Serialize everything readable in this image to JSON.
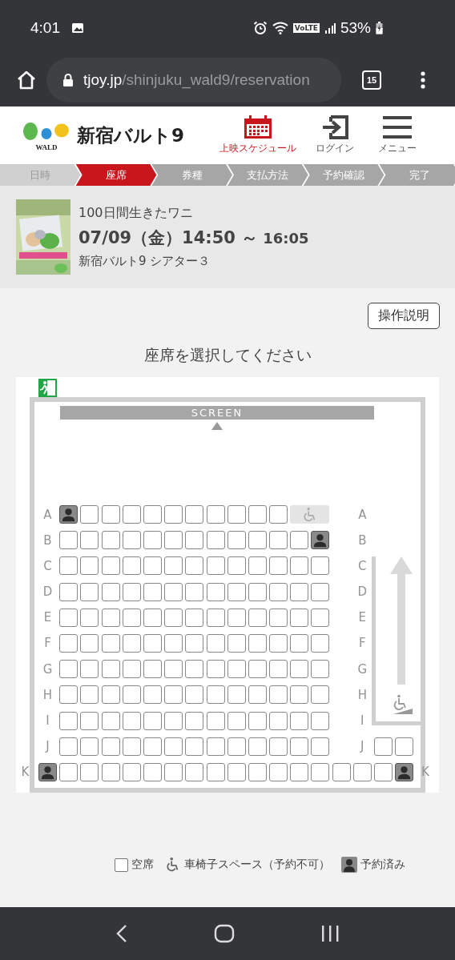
{
  "status_bar": {
    "time": "4:01",
    "network": "VoLTE",
    "battery": "53%"
  },
  "browser": {
    "domain": "tjoy.jp",
    "path": "/shinjuku_wald9/reservation",
    "tabs_count": "15"
  },
  "header": {
    "logo_mark": "WALD",
    "site_name": "新宿バルト9",
    "nav": [
      {
        "label": "上映スケジュール",
        "kind": "schedule"
      },
      {
        "label": "ログイン",
        "kind": "login"
      },
      {
        "label": "メニュー",
        "kind": "menu"
      }
    ]
  },
  "steps": [
    {
      "label": "日時",
      "selected": false
    },
    {
      "label": "座席",
      "selected": true
    },
    {
      "label": "券種",
      "selected": false
    },
    {
      "label": "支払方法",
      "selected": false
    },
    {
      "label": "予約確認",
      "selected": false
    },
    {
      "label": "完了",
      "selected": false
    }
  ],
  "movie": {
    "title": "100日間生きたワニ",
    "start": "07/09（金）14:50 ～",
    "end": "16:05",
    "theater": "新宿バルト9 シアター３"
  },
  "help_button": "操作説明",
  "instruction": "座席を選択してください",
  "seat_map": {
    "screen_label": "SCREEN",
    "rows": [
      {
        "label_left": "A",
        "label_right": "A",
        "kind": "standard",
        "seats": [
          {
            "kind": "seat",
            "reserved": true
          },
          {
            "kind": "seat",
            "reserved": false
          },
          {
            "kind": "seat",
            "reserved": false
          },
          {
            "kind": "seat",
            "reserved": false
          },
          {
            "kind": "seat",
            "reserved": false
          },
          {
            "kind": "seat",
            "reserved": false
          },
          {
            "kind": "seat",
            "reserved": false
          },
          {
            "kind": "seat",
            "reserved": false
          },
          {
            "kind": "seat",
            "reserved": false
          },
          {
            "kind": "seat",
            "reserved": false
          },
          {
            "kind": "seat",
            "reserved": false
          },
          {
            "kind": "wheelchair"
          }
        ]
      },
      {
        "label_left": "B",
        "label_right": "B",
        "kind": "standard",
        "seats": [
          {
            "kind": "seat",
            "reserved": false
          },
          {
            "kind": "seat",
            "reserved": false
          },
          {
            "kind": "seat",
            "reserved": false
          },
          {
            "kind": "seat",
            "reserved": false
          },
          {
            "kind": "seat",
            "reserved": false
          },
          {
            "kind": "seat",
            "reserved": false
          },
          {
            "kind": "seat",
            "reserved": false
          },
          {
            "kind": "seat",
            "reserved": false
          },
          {
            "kind": "seat",
            "reserved": false
          },
          {
            "kind": "seat",
            "reserved": false
          },
          {
            "kind": "seat",
            "reserved": false
          },
          {
            "kind": "seat",
            "reserved": false
          },
          {
            "kind": "seat",
            "reserved": true
          }
        ]
      },
      {
        "label_left": "C",
        "label_right": "C",
        "kind": "standard",
        "seats": [
          {
            "kind": "seat",
            "reserved": false
          },
          {
            "kind": "seat",
            "reserved": false
          },
          {
            "kind": "seat",
            "reserved": false
          },
          {
            "kind": "seat",
            "reserved": false
          },
          {
            "kind": "seat",
            "reserved": false
          },
          {
            "kind": "seat",
            "reserved": false
          },
          {
            "kind": "seat",
            "reserved": false
          },
          {
            "kind": "seat",
            "reserved": false
          },
          {
            "kind": "seat",
            "reserved": false
          },
          {
            "kind": "seat",
            "reserved": false
          },
          {
            "kind": "seat",
            "reserved": false
          },
          {
            "kind": "seat",
            "reserved": false
          },
          {
            "kind": "seat",
            "reserved": false
          }
        ]
      },
      {
        "label_left": "D",
        "label_right": "D",
        "kind": "standard",
        "seats": [
          {
            "kind": "seat",
            "reserved": false
          },
          {
            "kind": "seat",
            "reserved": false
          },
          {
            "kind": "seat",
            "reserved": false
          },
          {
            "kind": "seat",
            "reserved": false
          },
          {
            "kind": "seat",
            "reserved": false
          },
          {
            "kind": "seat",
            "reserved": false
          },
          {
            "kind": "seat",
            "reserved": false
          },
          {
            "kind": "seat",
            "reserved": false
          },
          {
            "kind": "seat",
            "reserved": false
          },
          {
            "kind": "seat",
            "reserved": false
          },
          {
            "kind": "seat",
            "reserved": false
          },
          {
            "kind": "seat",
            "reserved": false
          },
          {
            "kind": "seat",
            "reserved": false
          }
        ]
      },
      {
        "label_left": "E",
        "label_right": "E",
        "kind": "standard",
        "seats": [
          {
            "kind": "seat",
            "reserved": false
          },
          {
            "kind": "seat",
            "reserved": false
          },
          {
            "kind": "seat",
            "reserved": false
          },
          {
            "kind": "seat",
            "reserved": false
          },
          {
            "kind": "seat",
            "reserved": false
          },
          {
            "kind": "seat",
            "reserved": false
          },
          {
            "kind": "seat",
            "reserved": false
          },
          {
            "kind": "seat",
            "reserved": false
          },
          {
            "kind": "seat",
            "reserved": false
          },
          {
            "kind": "seat",
            "reserved": false
          },
          {
            "kind": "seat",
            "reserved": false
          },
          {
            "kind": "seat",
            "reserved": false
          },
          {
            "kind": "seat",
            "reserved": false
          }
        ]
      },
      {
        "label_left": "F",
        "label_right": "F",
        "kind": "standard",
        "seats": [
          {
            "kind": "seat",
            "reserved": false
          },
          {
            "kind": "seat",
            "reserved": false
          },
          {
            "kind": "seat",
            "reserved": false
          },
          {
            "kind": "seat",
            "reserved": false
          },
          {
            "kind": "seat",
            "reserved": false
          },
          {
            "kind": "seat",
            "reserved": false
          },
          {
            "kind": "seat",
            "reserved": false
          },
          {
            "kind": "seat",
            "reserved": false
          },
          {
            "kind": "seat",
            "reserved": false
          },
          {
            "kind": "seat",
            "reserved": false
          },
          {
            "kind": "seat",
            "reserved": false
          },
          {
            "kind": "seat",
            "reserved": false
          },
          {
            "kind": "seat",
            "reserved": false
          }
        ]
      },
      {
        "label_left": "G",
        "label_right": "G",
        "kind": "standard",
        "seats": [
          {
            "kind": "seat",
            "reserved": false
          },
          {
            "kind": "seat",
            "reserved": false
          },
          {
            "kind": "seat",
            "reserved": false
          },
          {
            "kind": "seat",
            "reserved": false
          },
          {
            "kind": "seat",
            "reserved": false
          },
          {
            "kind": "seat",
            "reserved": false
          },
          {
            "kind": "seat",
            "reserved": false
          },
          {
            "kind": "seat",
            "reserved": false
          },
          {
            "kind": "seat",
            "reserved": false
          },
          {
            "kind": "seat",
            "reserved": false
          },
          {
            "kind": "seat",
            "reserved": false
          },
          {
            "kind": "seat",
            "reserved": false
          },
          {
            "kind": "seat",
            "reserved": false
          }
        ]
      },
      {
        "label_left": "H",
        "label_right": "H",
        "kind": "standard",
        "seats": [
          {
            "kind": "seat",
            "reserved": false
          },
          {
            "kind": "seat",
            "reserved": false
          },
          {
            "kind": "seat",
            "reserved": false
          },
          {
            "kind": "seat",
            "reserved": false
          },
          {
            "kind": "seat",
            "reserved": false
          },
          {
            "kind": "seat",
            "reserved": false
          },
          {
            "kind": "seat",
            "reserved": false
          },
          {
            "kind": "seat",
            "reserved": false
          },
          {
            "kind": "seat",
            "reserved": false
          },
          {
            "kind": "seat",
            "reserved": false
          },
          {
            "kind": "seat",
            "reserved": false
          },
          {
            "kind": "seat",
            "reserved": false
          },
          {
            "kind": "seat",
            "reserved": false
          }
        ]
      },
      {
        "label_left": "I",
        "label_right": "I",
        "kind": "standard",
        "seats": [
          {
            "kind": "seat",
            "reserved": false
          },
          {
            "kind": "seat",
            "reserved": false
          },
          {
            "kind": "seat",
            "reserved": false
          },
          {
            "kind": "seat",
            "reserved": false
          },
          {
            "kind": "seat",
            "reserved": false
          },
          {
            "kind": "seat",
            "reserved": false
          },
          {
            "kind": "seat",
            "reserved": false
          },
          {
            "kind": "seat",
            "reserved": false
          },
          {
            "kind": "seat",
            "reserved": false
          },
          {
            "kind": "seat",
            "reserved": false
          },
          {
            "kind": "seat",
            "reserved": false
          },
          {
            "kind": "seat",
            "reserved": false
          },
          {
            "kind": "seat",
            "reserved": false
          }
        ]
      },
      {
        "label_left": "J",
        "label_right": "J",
        "kind": "standard",
        "seats": [
          {
            "kind": "seat",
            "reserved": false
          },
          {
            "kind": "seat",
            "reserved": false
          },
          {
            "kind": "seat",
            "reserved": false
          },
          {
            "kind": "seat",
            "reserved": false
          },
          {
            "kind": "seat",
            "reserved": false
          },
          {
            "kind": "seat",
            "reserved": false
          },
          {
            "kind": "seat",
            "reserved": false
          },
          {
            "kind": "seat",
            "reserved": false
          },
          {
            "kind": "seat",
            "reserved": false
          },
          {
            "kind": "seat",
            "reserved": false
          },
          {
            "kind": "seat",
            "reserved": false
          },
          {
            "kind": "seat",
            "reserved": false
          },
          {
            "kind": "seat",
            "reserved": false
          }
        ],
        "extra_seats": [
          {
            "kind": "seat",
            "reserved": false
          },
          {
            "kind": "seat",
            "reserved": false
          }
        ]
      },
      {
        "label_left": "K",
        "label_right": "K",
        "kind": "wide",
        "seats": [
          {
            "kind": "seat",
            "reserved": true
          },
          {
            "kind": "seat",
            "reserved": false
          },
          {
            "kind": "seat",
            "reserved": false
          },
          {
            "kind": "seat",
            "reserved": false
          },
          {
            "kind": "seat",
            "reserved": false
          },
          {
            "kind": "seat",
            "reserved": false
          },
          {
            "kind": "seat",
            "reserved": false
          },
          {
            "kind": "seat",
            "reserved": false
          },
          {
            "kind": "seat",
            "reserved": false
          },
          {
            "kind": "seat",
            "reserved": false
          },
          {
            "kind": "seat",
            "reserved": false
          },
          {
            "kind": "seat",
            "reserved": false
          },
          {
            "kind": "seat",
            "reserved": false
          },
          {
            "kind": "seat",
            "reserved": false
          },
          {
            "kind": "seat",
            "reserved": false
          },
          {
            "kind": "seat",
            "reserved": false
          },
          {
            "kind": "seat",
            "reserved": false
          },
          {
            "kind": "seat",
            "reserved": true
          }
        ]
      }
    ]
  },
  "legend": [
    {
      "label": "空席",
      "kind": "available"
    },
    {
      "label": "車椅子スペース（予約不可）",
      "kind": "wheelchair"
    },
    {
      "label": "予約済み",
      "kind": "reserved"
    }
  ]
}
